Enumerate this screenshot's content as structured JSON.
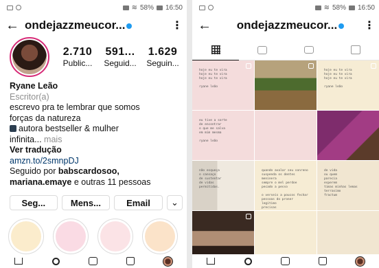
{
  "status_bar": {
    "battery": "58%",
    "time": "16:50"
  },
  "profile": {
    "username": "ondejazzmeucor...",
    "username_short": "ondejazzmeucor...",
    "stats": [
      {
        "number": "2.710",
        "label": "Public..."
      },
      {
        "number": "591...",
        "label": "Seguid..."
      },
      {
        "number": "1.629",
        "label": "Seguin..."
      }
    ],
    "name": "Ryane Leão",
    "category": "Escritor(a)",
    "bio_line1": "escrevo pra te lembrar que somos",
    "bio_line2": "forças da natureza",
    "bio_line3": "autora bestseller & mulher",
    "bio_line4": "infinita...",
    "bio_more": "mais",
    "translate": "Ver tradução",
    "link": "amzn.to/2smnpDJ",
    "followed_by_prefix": "Seguido por",
    "followed_by_bold": "babscardosoo,",
    "followed_by_bold2": "mariana.emaye",
    "followed_by_suffix": "e outras 11 pessoas"
  },
  "buttons": {
    "following": "Seg...",
    "message": "Mens...",
    "email": "Email",
    "more": "⌄"
  },
  "highlights": {
    "colors": [
      "#fbeccc",
      "#fadbe4",
      "#fbe3e6",
      "#fbe3c9"
    ],
    "labels": [
      "",
      "",
      "",
      ""
    ]
  },
  "tabs": [
    "grid-icon",
    "reels-icon",
    "igtv-icon",
    "tagged-icon"
  ],
  "posts": [
    {
      "style": "p-pink",
      "text": "hoje eu te vira\nhoje eu te vira\nhoje eu te vira\n\nryane leão",
      "multi": true
    },
    {
      "style": "p-photo1",
      "text": "",
      "multi": true
    },
    {
      "style": "p-cream",
      "text": "hoje eu te vira\nhoje eu te vira\nhoje eu te vira\n\nryane leão",
      "multi": true
    },
    {
      "style": "p-pink",
      "text": "eu tive a sorte\nde encontrar\no que me salva\nem mim mesma\n\nryane leão",
      "multi": false
    },
    {
      "style": "p-pink",
      "text": "",
      "multi": false
    },
    {
      "style": "p-photo2",
      "text": "",
      "multi": false
    },
    {
      "style": "p-book",
      "text": "não esqueça\no cansaço\nde sustentar\nde vidas\npermitidas.",
      "multi": false
    },
    {
      "style": "p-cream",
      "text": "quando avalar seu sonreno\nsuspenda os dentes meninera\nsempre o mel perdoe\npecado a pesso\n\no verseis a poucos fechar\npessoas do proner\nlegitimo\nprecisas",
      "multi": false
    },
    {
      "style": "p-beige",
      "text": "de vida\nou quem\nparecia\nesperem\ntimas minhas lemas\nterrasimo\nfractum",
      "multi": false
    },
    {
      "style": "p-dark",
      "text": "",
      "multi": true
    },
    {
      "style": "p-cream",
      "text": "",
      "multi": false
    },
    {
      "style": "p-beige",
      "text": "",
      "multi": false
    }
  ],
  "nav": [
    "home-icon",
    "search-icon",
    "reels-icon",
    "shop-icon",
    "profile-icon"
  ]
}
